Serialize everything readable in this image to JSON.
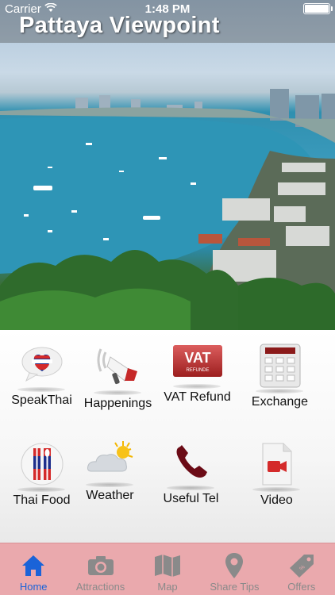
{
  "status_bar": {
    "carrier": "Carrier",
    "time": "1:48 PM"
  },
  "hero": {
    "title": "Pattaya Viewpoint"
  },
  "grid": {
    "items": [
      {
        "label": "SpeakThai"
      },
      {
        "label": "Happenings"
      },
      {
        "label": "VAT Refund",
        "icon_text": "VAT",
        "icon_subtext": "REFUNDE"
      },
      {
        "label": "Exchange"
      },
      {
        "label": "Thai Food"
      },
      {
        "label": "Weather"
      },
      {
        "label": "Useful Tel"
      },
      {
        "label": "Video"
      }
    ]
  },
  "tabbar": {
    "active": "Home",
    "items": [
      {
        "label": "Home",
        "icon": "home-icon"
      },
      {
        "label": "Attractions",
        "icon": "camera-icon"
      },
      {
        "label": "Map",
        "icon": "map-icon"
      },
      {
        "label": "Share Tips",
        "icon": "location-pin-icon"
      },
      {
        "label": "Offers",
        "icon": "tag-icon"
      }
    ]
  },
  "colors": {
    "tabbar_bg": "#eaa9ad",
    "active_tab": "#1a63d8",
    "inactive_tab": "#8a8a8a"
  }
}
